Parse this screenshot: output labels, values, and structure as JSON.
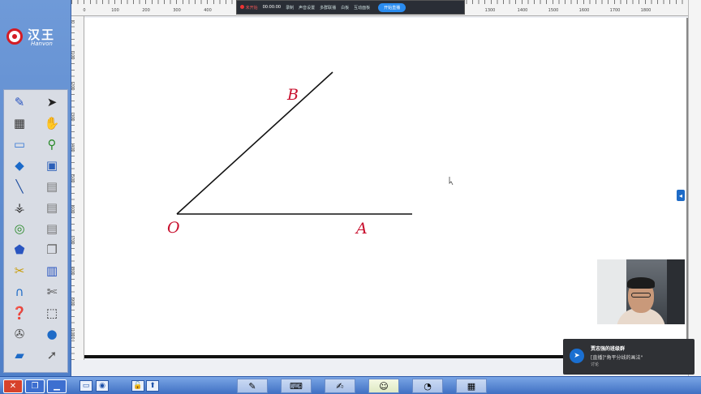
{
  "logo": {
    "name": "汉王",
    "sub": "Hanvon"
  },
  "recording": {
    "status": "未开始",
    "time": "00:00:00",
    "items": [
      "录制",
      "声音设置",
      "多群联播",
      "白板",
      "互动面板"
    ],
    "start_label": "开始直播"
  },
  "ruler": {
    "top_ticks": [
      "0",
      "100",
      "200",
      "300",
      "400",
      "1300",
      "1400",
      "1500",
      "1600",
      "1700",
      "1800"
    ],
    "left_ticks": [
      "0",
      "100",
      "200",
      "300",
      "400",
      "500",
      "600",
      "700",
      "800",
      "900",
      "1000"
    ]
  },
  "geometry": {
    "labels": {
      "O": "O",
      "A": "A",
      "B": "B"
    },
    "stroke_color": "#111111",
    "label_color": "#c8102e"
  },
  "notification": {
    "title": "贾志强的班级群",
    "message": "[直播]\"角平分线的画法\"",
    "sub": "讨论"
  },
  "tools": [
    "pen-icon",
    "arrow-cursor-icon",
    "brush-icon",
    "hand-icon",
    "eraser-icon",
    "zoom-icon",
    "fill-bucket-icon",
    "save-icon",
    "line-icon",
    "page-icon",
    "compass-icon",
    "page-icon",
    "shapes-icon",
    "page-icon",
    "solids-icon",
    "copy-icon",
    "ruler-icon",
    "paste-icon",
    "magnet-icon",
    "cut-icon",
    "help-icon",
    "select-icon",
    "wrench-icon",
    "record-icon",
    "folder-icon",
    "export-icon"
  ],
  "colors": {
    "accent": "#2a8cf0",
    "panel": "#5a86cc",
    "taskbar": "#3f6fc2"
  }
}
